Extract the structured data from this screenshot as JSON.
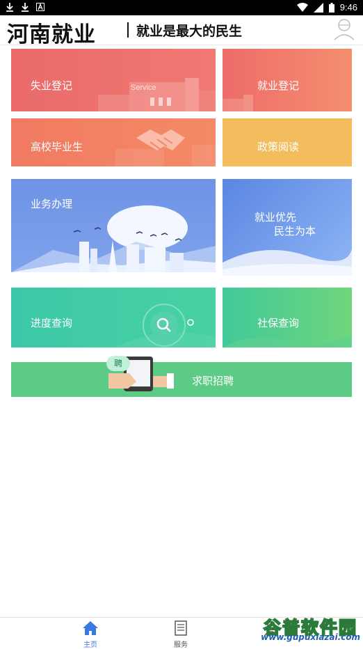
{
  "status_bar": {
    "time": "9:46",
    "left_icons": [
      "download-icon",
      "download-icon",
      "notification-a-icon"
    ],
    "right_icons": [
      "wifi-icon",
      "signal-icon",
      "battery-icon"
    ]
  },
  "header": {
    "logo_text": "河南就业",
    "slogan": "就业是最大的民生",
    "avatar_icon": "user-avatar-icon"
  },
  "tiles": {
    "shiye": {
      "label": "失业登记",
      "deco_text": "Service"
    },
    "jiuye": {
      "label": "就业登记"
    },
    "gaoxiao": {
      "label": "高校毕业生"
    },
    "zhengce": {
      "label": "政策阅读"
    },
    "yewu": {
      "label": "业务办理"
    },
    "jiuyeyx": {
      "line1": "就业优先",
      "line2": "民生为本"
    },
    "jindu": {
      "label": "进度查询"
    },
    "shebao": {
      "label": "社保查询"
    },
    "qiuzhi": {
      "label": "求职招聘",
      "badge": "聘"
    }
  },
  "bottom_nav": {
    "items": [
      {
        "label": "主页",
        "icon": "home-icon",
        "active": true
      },
      {
        "label": "服务",
        "icon": "document-icon",
        "active": false
      },
      {
        "label": "",
        "icon": "profile-icon",
        "active": false
      }
    ]
  },
  "watermark": {
    "title": "谷普软件园",
    "url": "www.gupuxiazai.com"
  },
  "colors": {
    "accent_blue": "#3a7ae0",
    "red_tile": "#ea6a6a",
    "yellow_tile": "#f3bd5e",
    "blue_tile": "#6f93e6",
    "green_tile": "#3cc8a8",
    "recruit_tile": "#5dcb86"
  }
}
